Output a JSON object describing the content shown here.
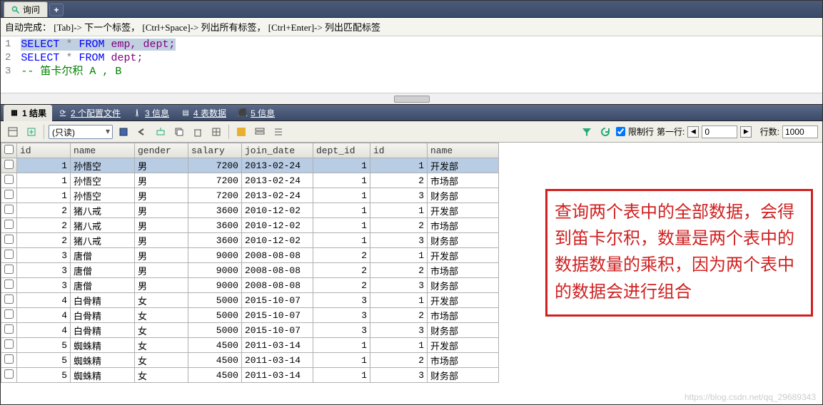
{
  "tab": {
    "title": "询问"
  },
  "hint": "自动完成： [Tab]-> 下一个标签， [Ctrl+Space]-> 列出所有标签， [Ctrl+Enter]-> 列出匹配标签",
  "editor": {
    "lines": [
      "1",
      "2",
      "3"
    ],
    "sql1_select": "SELECT",
    "sql1_star": "*",
    "sql1_from": "FROM",
    "sql1_rest": "emp, dept;",
    "sql2_select": "SELECT",
    "sql2_star": "*",
    "sql2_from": "FROM",
    "sql2_rest": "dept;",
    "sql3_comment": "-- 笛卡尔积 A , B"
  },
  "panel_tabs": {
    "results": "1 结果",
    "profiles": "2 个配置文件",
    "info": "3 信息",
    "tabledata": "4 表数据",
    "info2": "5 信息"
  },
  "toolbar": {
    "mode": "(只读)",
    "limit_label": "限制行",
    "first_row_label": "第一行:",
    "first_row_value": "0",
    "rows_label": "行数:",
    "rows_value": "1000"
  },
  "columns": [
    "id",
    "name",
    "gender",
    "salary",
    "join_date",
    "dept_id",
    "id",
    "name"
  ],
  "rows": [
    {
      "id": 1,
      "name": "孙悟空",
      "gender": "男",
      "salary": 7200,
      "join_date": "2013-02-24",
      "dept_id": 1,
      "id2": 1,
      "name2": "开发部",
      "sel": true
    },
    {
      "id": 1,
      "name": "孙悟空",
      "gender": "男",
      "salary": 7200,
      "join_date": "2013-02-24",
      "dept_id": 1,
      "id2": 2,
      "name2": "市场部"
    },
    {
      "id": 1,
      "name": "孙悟空",
      "gender": "男",
      "salary": 7200,
      "join_date": "2013-02-24",
      "dept_id": 1,
      "id2": 3,
      "name2": "财务部"
    },
    {
      "id": 2,
      "name": "猪八戒",
      "gender": "男",
      "salary": 3600,
      "join_date": "2010-12-02",
      "dept_id": 1,
      "id2": 1,
      "name2": "开发部"
    },
    {
      "id": 2,
      "name": "猪八戒",
      "gender": "男",
      "salary": 3600,
      "join_date": "2010-12-02",
      "dept_id": 1,
      "id2": 2,
      "name2": "市场部"
    },
    {
      "id": 2,
      "name": "猪八戒",
      "gender": "男",
      "salary": 3600,
      "join_date": "2010-12-02",
      "dept_id": 1,
      "id2": 3,
      "name2": "财务部"
    },
    {
      "id": 3,
      "name": "唐僧",
      "gender": "男",
      "salary": 9000,
      "join_date": "2008-08-08",
      "dept_id": 2,
      "id2": 1,
      "name2": "开发部"
    },
    {
      "id": 3,
      "name": "唐僧",
      "gender": "男",
      "salary": 9000,
      "join_date": "2008-08-08",
      "dept_id": 2,
      "id2": 2,
      "name2": "市场部"
    },
    {
      "id": 3,
      "name": "唐僧",
      "gender": "男",
      "salary": 9000,
      "join_date": "2008-08-08",
      "dept_id": 2,
      "id2": 3,
      "name2": "财务部"
    },
    {
      "id": 4,
      "name": "白骨精",
      "gender": "女",
      "salary": 5000,
      "join_date": "2015-10-07",
      "dept_id": 3,
      "id2": 1,
      "name2": "开发部"
    },
    {
      "id": 4,
      "name": "白骨精",
      "gender": "女",
      "salary": 5000,
      "join_date": "2015-10-07",
      "dept_id": 3,
      "id2": 2,
      "name2": "市场部"
    },
    {
      "id": 4,
      "name": "白骨精",
      "gender": "女",
      "salary": 5000,
      "join_date": "2015-10-07",
      "dept_id": 3,
      "id2": 3,
      "name2": "财务部"
    },
    {
      "id": 5,
      "name": "蜘蛛精",
      "gender": "女",
      "salary": 4500,
      "join_date": "2011-03-14",
      "dept_id": 1,
      "id2": 1,
      "name2": "开发部"
    },
    {
      "id": 5,
      "name": "蜘蛛精",
      "gender": "女",
      "salary": 4500,
      "join_date": "2011-03-14",
      "dept_id": 1,
      "id2": 2,
      "name2": "市场部"
    },
    {
      "id": 5,
      "name": "蜘蛛精",
      "gender": "女",
      "salary": 4500,
      "join_date": "2011-03-14",
      "dept_id": 1,
      "id2": 3,
      "name2": "财务部"
    }
  ],
  "annotation": "查询两个表中的全部数据，会得到笛卡尔积，数量是两个表中的数据数量的乘积，因为两个表中的数据会进行组合",
  "watermark": "https://blog.csdn.net/qq_29689343"
}
